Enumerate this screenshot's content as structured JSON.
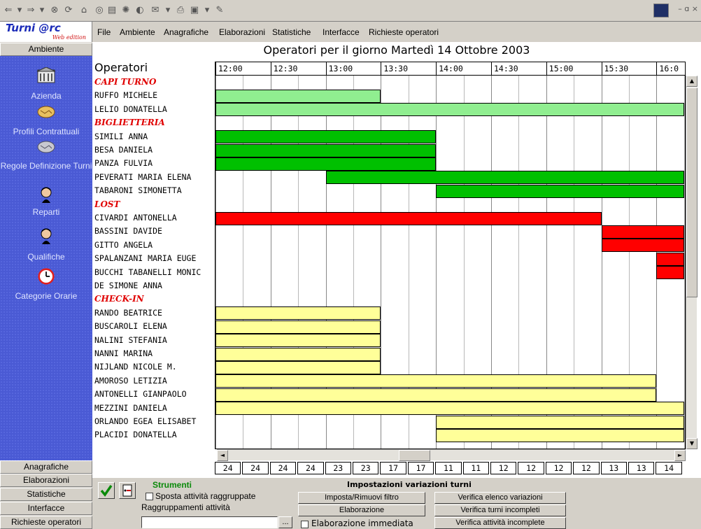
{
  "browser": {
    "toolbar_icons": [
      "back-arrow-icon",
      "forward-arrow-icon",
      "stop-icon",
      "refresh-icon",
      "home-icon",
      "search-icon",
      "favorites-icon",
      "history-icon",
      "media-icon",
      "mail-icon",
      "print-icon",
      "edit-icon",
      "discuss-icon"
    ],
    "window_controls": "– ɑ ×"
  },
  "brand": {
    "title": "Turni @rc",
    "subtitle": "Web edition"
  },
  "menu": [
    "File",
    "Ambiente",
    "Anagrafiche",
    "Elaborazioni",
    "Statistiche",
    "Interfacce",
    "Richieste operatori"
  ],
  "sidebar": {
    "top_button": "Ambiente",
    "items": [
      {
        "label": "Azienda",
        "icon": "bank-building-icon"
      },
      {
        "label": "Profili Contrattuali",
        "icon": "handshake-icon"
      },
      {
        "label": "Regole Definizione Turni",
        "icon": "handshake-grey-icon"
      },
      {
        "label": "Reparti",
        "icon": "person-icon"
      },
      {
        "label": "Qualifiche",
        "icon": "person-icon"
      },
      {
        "label": "Categorie Orarie",
        "icon": "clock-icon"
      }
    ],
    "bottom_buttons": [
      "Anagrafiche",
      "Elaborazioni",
      "Statistiche",
      "Interfacce",
      "Richieste operatori"
    ]
  },
  "main": {
    "title": "Operatori per il giorno Martedì 14 Ottobre 2003",
    "ops_header": "Operatori",
    "time_labels": [
      "12:00",
      "12:30",
      "13:00",
      "13:30",
      "14:00",
      "14:30",
      "15:00",
      "15:30",
      "16:0"
    ],
    "rows": [
      {
        "name": "CAPI TURNO",
        "group": true
      },
      {
        "name": "RUFFO MICHELE"
      },
      {
        "name": "LELIO DONATELLA"
      },
      {
        "name": "BIGLIETTERIA",
        "group": true
      },
      {
        "name": "SIMILI ANNA"
      },
      {
        "name": "BESA DANIELA"
      },
      {
        "name": "PANZA FULVIA"
      },
      {
        "name": "PEVERATI MARIA ELENA"
      },
      {
        "name": "TABARONI SIMONETTA"
      },
      {
        "name": "LOST",
        "group": true
      },
      {
        "name": "CIVARDI ANTONELLA"
      },
      {
        "name": "BASSINI DAVIDE"
      },
      {
        "name": "GITTO ANGELA"
      },
      {
        "name": "SPALANZANI MARIA EUGE"
      },
      {
        "name": "BUCCHI TABANELLI MONIC"
      },
      {
        "name": "DE SIMONE ANNA"
      },
      {
        "name": "CHECK-IN",
        "group": true
      },
      {
        "name": "RANDO BEATRICE"
      },
      {
        "name": "BUSCAROLI ELENA"
      },
      {
        "name": "NALINI STEFANIA"
      },
      {
        "name": "NANNI MARINA"
      },
      {
        "name": "NIJLAND NICOLE M."
      },
      {
        "name": "AMOROSO LETIZIA"
      },
      {
        "name": "ANTONELLI GIANPAOLO"
      },
      {
        "name": "MEZZINI DANIELA"
      },
      {
        "name": "ORLANDO EGEA ELISABET"
      },
      {
        "name": "PLACIDI DONATELLA"
      }
    ],
    "counts": [
      "24",
      "24",
      "24",
      "24",
      "23",
      "23",
      "17",
      "17",
      "11",
      "11",
      "12",
      "12",
      "12",
      "12",
      "13",
      "13",
      "14"
    ]
  },
  "chart_data": {
    "type": "table",
    "title": "Operatori per il giorno Martedì 14 Ottobre 2003",
    "x_start": "12:00",
    "slot_minutes": 15,
    "bars": [
      {
        "row": 1,
        "start": "12:00",
        "end": "13:30",
        "color": "#90ee90"
      },
      {
        "row": 2,
        "start": "12:00",
        "end": "16:15",
        "color": "#90ee90"
      },
      {
        "row": 4,
        "start": "12:00",
        "end": "14:00",
        "color": "#00c000"
      },
      {
        "row": 5,
        "start": "12:00",
        "end": "14:00",
        "color": "#00c000"
      },
      {
        "row": 6,
        "start": "12:00",
        "end": "14:00",
        "color": "#00c000"
      },
      {
        "row": 7,
        "start": "13:00",
        "end": "16:15",
        "color": "#00c000"
      },
      {
        "row": 8,
        "start": "14:00",
        "end": "16:15",
        "color": "#00c000"
      },
      {
        "row": 10,
        "start": "12:00",
        "end": "15:30",
        "color": "#ff0000"
      },
      {
        "row": 11,
        "start": "15:30",
        "end": "16:15",
        "color": "#ff0000"
      },
      {
        "row": 12,
        "start": "15:30",
        "end": "16:15",
        "color": "#ff0000"
      },
      {
        "row": 13,
        "start": "16:00",
        "end": "16:15",
        "color": "#ff0000"
      },
      {
        "row": 14,
        "start": "16:00",
        "end": "16:15",
        "color": "#ff0000"
      },
      {
        "row": 17,
        "start": "12:00",
        "end": "13:30",
        "color": "#ffff99"
      },
      {
        "row": 18,
        "start": "12:00",
        "end": "13:30",
        "color": "#ffff99"
      },
      {
        "row": 19,
        "start": "12:00",
        "end": "13:30",
        "color": "#ffff99"
      },
      {
        "row": 20,
        "start": "12:00",
        "end": "13:30",
        "color": "#ffff99"
      },
      {
        "row": 21,
        "start": "12:00",
        "end": "13:30",
        "color": "#ffff99"
      },
      {
        "row": 22,
        "start": "12:00",
        "end": "16:00",
        "color": "#ffff99"
      },
      {
        "row": 23,
        "start": "12:00",
        "end": "16:00",
        "color": "#ffff99"
      },
      {
        "row": 24,
        "start": "12:00",
        "end": "16:15",
        "color": "#ffff99"
      },
      {
        "row": 25,
        "start": "14:00",
        "end": "16:15",
        "color": "#ffff99"
      },
      {
        "row": 26,
        "start": "14:00",
        "end": "16:15",
        "color": "#ffff99"
      }
    ]
  },
  "tools": {
    "title": "Strumenti",
    "chk_sposta": "Sposta attività raggruppate",
    "raggruppamenti_label": "Raggruppamenti attività",
    "browse_button": "...",
    "impostazioni_title": "Impostazioni variazioni turni",
    "btn_filtro": "Imposta/Rimuovi filtro",
    "btn_elaborazione": "Elaborazione",
    "chk_elab_immediata": "Elaborazione immediata",
    "btn_verifica_elenco": "Verifica elenco variazioni",
    "btn_verifica_turni": "Verifica turni incompleti",
    "btn_verifica_attivita": "Verifica attività incomplete"
  }
}
